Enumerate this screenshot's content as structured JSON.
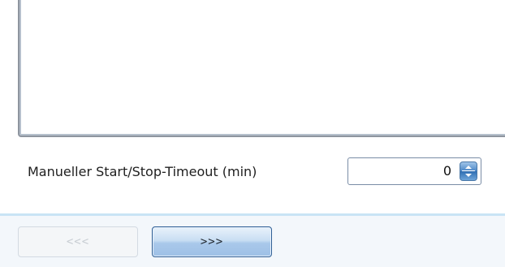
{
  "timeout": {
    "label": "Manueller Start/Stop-Timeout (min)",
    "value": "0",
    "spin_icon": "spin-up-down-icon"
  },
  "navigation": {
    "back_label": "<<<",
    "next_label": ">>>",
    "back_enabled": false,
    "next_enabled": true
  },
  "colors": {
    "accent": "#4a86c6",
    "bar_background": "#f3f7fb",
    "bar_border": "#c9e4f5"
  }
}
